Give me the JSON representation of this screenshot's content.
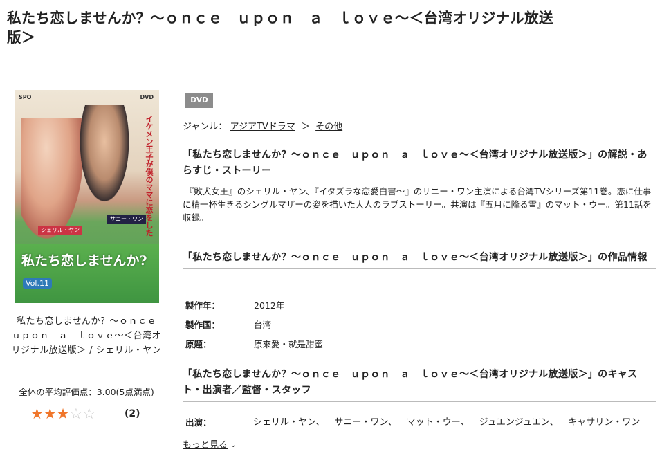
{
  "page": {
    "title": "私たち恋しませんか？～ｏｎｃｅ　ｕｐｏｎ　ａ　ｌｏｖｅ～＜台湾オリジナル放送版＞"
  },
  "cover": {
    "logo_left": "SPO",
    "logo_right": "DVD",
    "tagline": "イケメン王子が僕のママに恋をした",
    "title": "私たち恋しませんか?",
    "volume": "Vol.11",
    "cast_left": "シェリル・ヤン",
    "cast_right": "サニー・ワン",
    "caption": "私たち恋しませんか？～ｏｎｃｅ　ｕｐｏｎ　ａ　ｌｏｖｅ～＜台湾オリジナル放送版＞ / シェリル・ヤン"
  },
  "rating": {
    "average_label": "全体の平均評価点：3.00(5点満点)",
    "stars_filled": 3,
    "stars_total": 5,
    "review_count": "(2)"
  },
  "badge": {
    "format": "DVD"
  },
  "genre": {
    "label": "ジャンル：",
    "items": [
      "アジアTVドラマ",
      "その他"
    ],
    "separator": "＞"
  },
  "synopsis_section": {
    "heading": "「私たち恋しませんか？～ｏｎｃｅ　ｕｐｏｎ　ａ　ｌｏｖｅ～＜台湾オリジナル放送版＞」の解説・あらすじ・ストーリー",
    "text": "『敗犬女王』のシェリル・ヤン、『イタズラな恋愛白書～』のサニー・ワン主演による台湾TVシリーズ第11巻。恋に仕事に精一杯生きるシングルマザーの姿を描いた大人のラブストーリー。共演は『五月に降る雪』のマット・ウー。第11話を収録。"
  },
  "info_section": {
    "heading": "「私たち恋しませんか？～ｏｎｃｅ　ｕｐｏｎ　ａ　ｌｏｖｅ～＜台湾オリジナル放送版＞」の作品情報",
    "rows": [
      {
        "label": "製作年：",
        "value": "2012年"
      },
      {
        "label": "製作国：",
        "value": "台湾"
      },
      {
        "label": "原題：",
        "value": "原來愛・就是甜蜜"
      }
    ]
  },
  "cast_section": {
    "heading": "「私たち恋しませんか？～ｏｎｃｅ　ｕｐｏｎ　ａ　ｌｏｖｅ～＜台湾オリジナル放送版＞」のキャスト・出演者／監督・スタッフ",
    "label": "出演：",
    "cast": [
      "シェリル・ヤン",
      "サニー・ワン",
      "マット・ウー",
      "ジュエンジュエン",
      "キャサリン・ワン"
    ],
    "separator": "、",
    "more_label": "もっと見る"
  }
}
